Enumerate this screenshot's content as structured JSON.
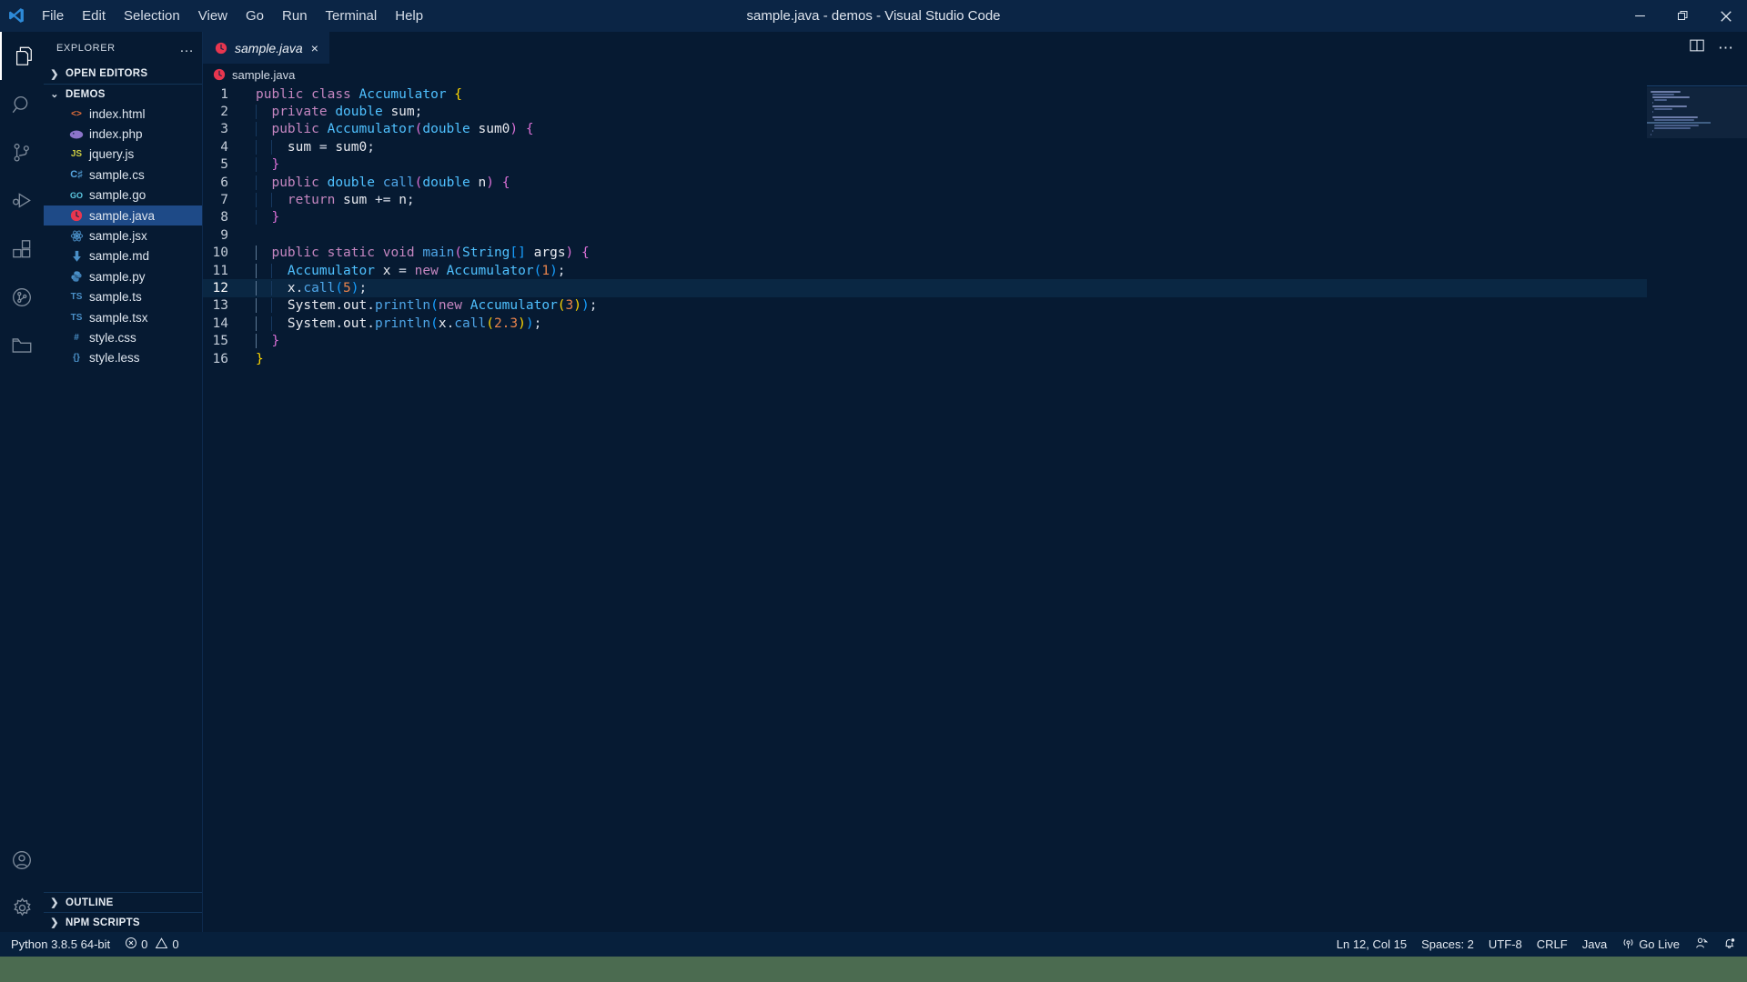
{
  "window": {
    "title": "sample.java - demos - Visual Studio Code",
    "minimize_label": "Minimize",
    "restore_label": "Restore",
    "close_label": "Close"
  },
  "menubar": {
    "items": [
      {
        "label": "File"
      },
      {
        "label": "Edit"
      },
      {
        "label": "Selection"
      },
      {
        "label": "View"
      },
      {
        "label": "Go"
      },
      {
        "label": "Run"
      },
      {
        "label": "Terminal"
      },
      {
        "label": "Help"
      }
    ]
  },
  "activitybar": {
    "items": [
      {
        "name": "explorer",
        "icon": "files-icon",
        "active": true
      },
      {
        "name": "search",
        "icon": "search-icon",
        "active": false
      },
      {
        "name": "source-control",
        "icon": "source-control-icon",
        "active": false
      },
      {
        "name": "run-and-debug",
        "icon": "run-debug-icon",
        "active": false
      },
      {
        "name": "extensions",
        "icon": "extensions-icon",
        "active": false
      },
      {
        "name": "gitlens",
        "icon": "gitlens-icon",
        "active": false
      },
      {
        "name": "explorer-folder",
        "icon": "folder-icon",
        "active": false
      }
    ],
    "bottom": [
      {
        "name": "accounts",
        "icon": "account-icon"
      },
      {
        "name": "manage",
        "icon": "gear-icon"
      }
    ]
  },
  "sidebar": {
    "title": "EXPLORER",
    "more_actions": "…",
    "sections": {
      "open_editors": "OPEN EDITORS",
      "demos": "DEMOS",
      "outline": "OUTLINE",
      "npm_scripts": "NPM SCRIPTS"
    },
    "files": [
      {
        "name": "index.html",
        "icon": "html-icon",
        "glyph": "<>",
        "color": "#e8703a",
        "selected": false
      },
      {
        "name": "index.php",
        "icon": "php-icon",
        "glyph": "◆",
        "color": "#8b74c9",
        "selected": false
      },
      {
        "name": "jquery.js",
        "icon": "js-icon",
        "glyph": "JS",
        "color": "#cbcb41",
        "selected": false
      },
      {
        "name": "sample.cs",
        "icon": "csharp-icon",
        "glyph": "C♯",
        "color": "#57a6e0",
        "selected": false
      },
      {
        "name": "sample.go",
        "icon": "go-icon",
        "glyph": "GO",
        "color": "#5dc9e2",
        "selected": false
      },
      {
        "name": "sample.java",
        "icon": "java-icon",
        "glyph": "J",
        "color": "#e8364f",
        "selected": true
      },
      {
        "name": "sample.jsx",
        "icon": "react-icon",
        "glyph": "⚛",
        "color": "#4a8fc7",
        "selected": false
      },
      {
        "name": "sample.md",
        "icon": "markdown-icon",
        "glyph": "⬇",
        "color": "#4a8fc7",
        "selected": false
      },
      {
        "name": "sample.py",
        "icon": "python-icon",
        "glyph": "ᴘ",
        "color": "#4a8fc7",
        "selected": false
      },
      {
        "name": "sample.ts",
        "icon": "typescript-icon",
        "glyph": "TS",
        "color": "#4a8fc7",
        "selected": false
      },
      {
        "name": "sample.tsx",
        "icon": "typescript-icon",
        "glyph": "TS",
        "color": "#4a8fc7",
        "selected": false
      },
      {
        "name": "style.css",
        "icon": "css-icon",
        "glyph": "#",
        "color": "#4a8fc7",
        "selected": false
      },
      {
        "name": "style.less",
        "icon": "less-icon",
        "glyph": "{}",
        "color": "#4a8fc7",
        "selected": false
      }
    ]
  },
  "editor": {
    "tab": {
      "label": "sample.java",
      "icon": "java-icon",
      "close": "×",
      "preview": true
    },
    "actions": [
      {
        "name": "split-editor-right",
        "icon": "split-editor-icon"
      },
      {
        "name": "more-actions",
        "icon": "ellipsis-icon"
      }
    ],
    "breadcrumb": {
      "icon": "java-icon",
      "label": "sample.java"
    },
    "cursor_line": 12,
    "lines": [
      {
        "n": 1,
        "text": "public class Accumulator {"
      },
      {
        "n": 2,
        "text": "  private double sum;"
      },
      {
        "n": 3,
        "text": "  public Accumulator(double sum0) {"
      },
      {
        "n": 4,
        "text": "    sum = sum0;"
      },
      {
        "n": 5,
        "text": "  }"
      },
      {
        "n": 6,
        "text": "  public double call(double n) {"
      },
      {
        "n": 7,
        "text": "    return sum += n;"
      },
      {
        "n": 8,
        "text": "  }"
      },
      {
        "n": 9,
        "text": ""
      },
      {
        "n": 10,
        "text": "  public static void main(String[] args) {"
      },
      {
        "n": 11,
        "text": "    Accumulator x = new Accumulator(1);"
      },
      {
        "n": 12,
        "text": "    x.call(5);"
      },
      {
        "n": 13,
        "text": "    System.out.println(new Accumulator(3));"
      },
      {
        "n": 14,
        "text": "    System.out.println(x.call(2.3));"
      },
      {
        "n": 15,
        "text": "  }"
      },
      {
        "n": 16,
        "text": "}"
      }
    ]
  },
  "statusbar": {
    "left": [
      {
        "name": "python-interpreter",
        "label": "Python 3.8.5 64-bit"
      },
      {
        "name": "problems",
        "label": "0",
        "label2": "0",
        "errors_icon": "error-circle-icon",
        "warnings_icon": "warning-triangle-icon"
      }
    ],
    "right": [
      {
        "name": "cursor-position",
        "label": "Ln 12, Col 15"
      },
      {
        "name": "indentation",
        "label": "Spaces: 2"
      },
      {
        "name": "encoding",
        "label": "UTF-8"
      },
      {
        "name": "eol",
        "label": "CRLF"
      },
      {
        "name": "language-mode",
        "label": "Java"
      },
      {
        "name": "go-live",
        "label": "Go Live",
        "icon": "broadcast-icon"
      },
      {
        "name": "feedback",
        "label": "",
        "icon": "feedback-icon"
      },
      {
        "name": "notifications",
        "label": "",
        "icon": "bell-dot-icon"
      }
    ]
  },
  "colors": {
    "titlebar_bg": "#0b2545",
    "editor_bg": "#061a32",
    "sidebar_bg": "#061a32",
    "selection_bg": "#1e4a87",
    "statusbar_bg": "#07203c",
    "accent": "#4fc1ff"
  }
}
